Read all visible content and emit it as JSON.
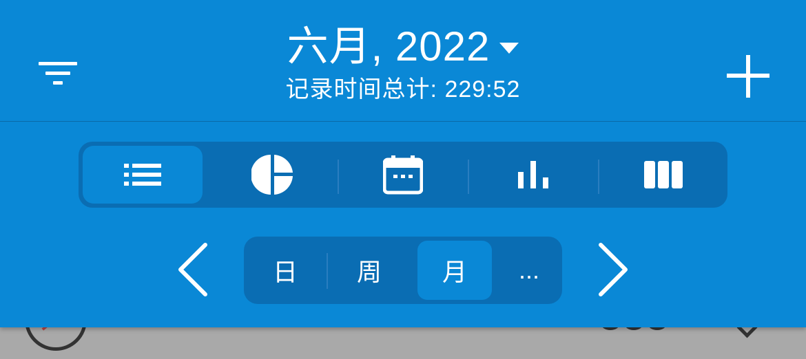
{
  "header": {
    "title": "六月, 2022",
    "subtitle": "记录时间总计: 229:52",
    "filter_icon": "filter-icon",
    "add_icon": "plus-icon",
    "background_color": "#0a88d6",
    "segment_color": "#0a6db3"
  },
  "view_tabs": [
    {
      "icon": "list-icon",
      "active": true
    },
    {
      "icon": "pie-chart-icon",
      "active": false
    },
    {
      "icon": "calendar-icon",
      "active": false
    },
    {
      "icon": "bar-chart-icon",
      "active": false
    },
    {
      "icon": "columns-icon",
      "active": false
    }
  ],
  "period": {
    "prev_icon": "chevron-left-icon",
    "next_icon": "chevron-right-icon",
    "options": [
      {
        "label": "日",
        "active": false
      },
      {
        "label": "周",
        "active": false
      },
      {
        "label": "月",
        "active": true
      },
      {
        "label": "...",
        "active": false
      }
    ]
  }
}
